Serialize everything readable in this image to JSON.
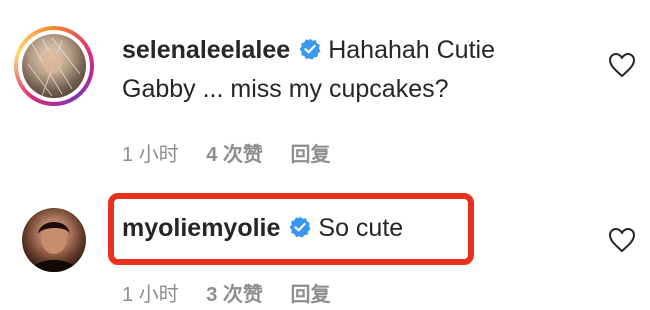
{
  "comments": [
    {
      "username": "selenaleelalee",
      "text_line1": "Hahahah Cutie",
      "text_line2": "Gabby ... miss my cupcakes?",
      "time": "1 小时",
      "likes": "4 次赞",
      "reply": "回复",
      "avatar_icon": "avatar-with-story-ring",
      "verified_icon": "verified-badge-icon",
      "like_icon": "heart-outline-icon"
    },
    {
      "username": "myoliemyolie",
      "text_line1": "So cute",
      "time": "1 小时",
      "likes": "3 次赞",
      "reply": "回复",
      "avatar_icon": "avatar",
      "verified_icon": "verified-badge-icon",
      "like_icon": "heart-outline-icon"
    }
  ],
  "colors": {
    "verified_blue": "#3897f0",
    "meta_gray": "#8e8e8e",
    "text": "#262626",
    "highlight_red": "#e8321f"
  }
}
